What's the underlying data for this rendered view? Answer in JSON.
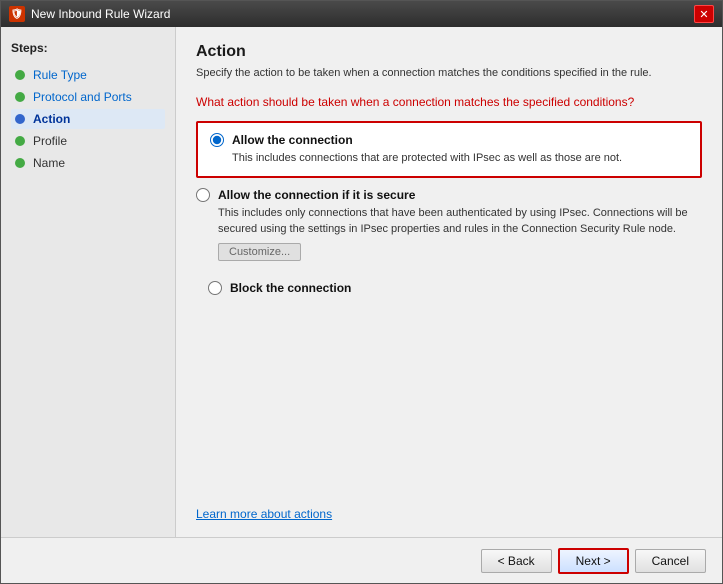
{
  "titlebar": {
    "title": "New Inbound Rule Wizard",
    "icon": "🛡",
    "close_label": "✕"
  },
  "page": {
    "title": "Action",
    "description": "Specify the action to be taken when a connection matches the conditions specified in the rule."
  },
  "sidebar": {
    "steps_label": "Steps:",
    "items": [
      {
        "id": "rule-type",
        "label": "Rule Type",
        "state": "done"
      },
      {
        "id": "protocol-ports",
        "label": "Protocol and Ports",
        "state": "done"
      },
      {
        "id": "action",
        "label": "Action",
        "state": "active"
      },
      {
        "id": "profile",
        "label": "Profile",
        "state": "inactive"
      },
      {
        "id": "name",
        "label": "Name",
        "state": "inactive"
      }
    ]
  },
  "question": "What action should be taken when a connection matches the specified conditions?",
  "options": [
    {
      "id": "allow",
      "label": "Allow the connection",
      "description": "This includes connections that are protected with IPsec as well as those are not.",
      "selected": true,
      "boxed": true
    },
    {
      "id": "allow-secure",
      "label": "Allow the connection if it is secure",
      "description": "This includes only connections that have been authenticated by using IPsec.  Connections will be secured using the settings in IPsec properties and rules in the Connection Security Rule node.",
      "selected": false,
      "has_customize": true
    },
    {
      "id": "block",
      "label": "Block the connection",
      "description": "",
      "selected": false
    }
  ],
  "customize_label": "Customize...",
  "learn_more": "Learn more about actions",
  "buttons": {
    "back": "< Back",
    "next": "Next >",
    "cancel": "Cancel"
  }
}
